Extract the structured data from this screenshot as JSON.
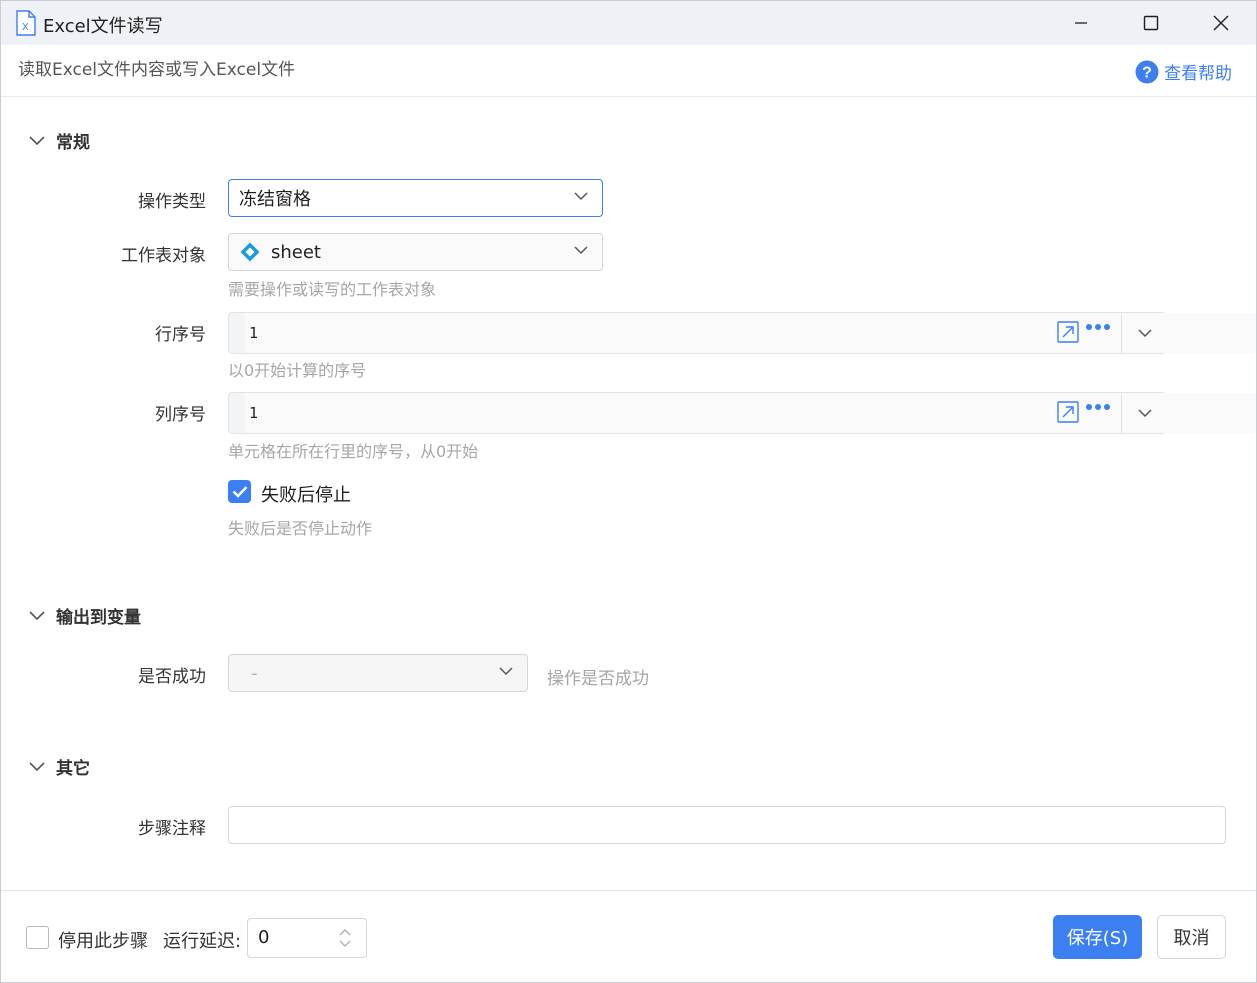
{
  "window": {
    "title": "Excel文件读写",
    "subtitle": "读取Excel文件内容或写入Excel文件",
    "help_label": "查看帮助"
  },
  "sections": {
    "general": {
      "title": "常规",
      "operation_type": {
        "label": "操作类型",
        "value": "冻结窗格"
      },
      "sheet_object": {
        "label": "工作表对象",
        "value": "sheet",
        "hint": "需要操作或读写的工作表对象"
      },
      "row_index": {
        "label": "行序号",
        "value": "1",
        "hint": "以0开始计算的序号"
      },
      "col_index": {
        "label": "列序号",
        "value": "1",
        "hint": "单元格在所在行里的序号，从0开始"
      },
      "stop_on_fail": {
        "label": "失败后停止",
        "checked": true,
        "hint": "失败后是否停止动作"
      }
    },
    "output": {
      "title": "输出到变量",
      "success": {
        "label": "是否成功",
        "value": "-",
        "hint": "操作是否成功"
      }
    },
    "other": {
      "title": "其它",
      "note": {
        "label": "步骤注释",
        "value": ""
      }
    }
  },
  "footer": {
    "disable_step_label": "停用此步骤",
    "disable_step_checked": false,
    "run_delay_label": "运行延迟:",
    "run_delay_value": "0",
    "save_label": "保存(S)",
    "cancel_label": "取消"
  },
  "colors": {
    "accent": "#3b7ff0",
    "sheet_icon": "#1e9bd7",
    "hint_text": "#a6a6a6"
  }
}
